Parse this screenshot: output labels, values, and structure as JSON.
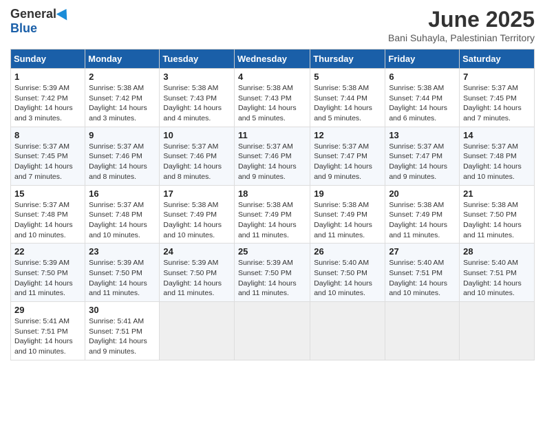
{
  "header": {
    "logo_general": "General",
    "logo_blue": "Blue",
    "month_title": "June 2025",
    "subtitle": "Bani Suhayla, Palestinian Territory"
  },
  "weekdays": [
    "Sunday",
    "Monday",
    "Tuesday",
    "Wednesday",
    "Thursday",
    "Friday",
    "Saturday"
  ],
  "weeks": [
    [
      {
        "day": "1",
        "sunrise": "Sunrise: 5:39 AM",
        "sunset": "Sunset: 7:42 PM",
        "daylight": "Daylight: 14 hours and 3 minutes."
      },
      {
        "day": "2",
        "sunrise": "Sunrise: 5:38 AM",
        "sunset": "Sunset: 7:42 PM",
        "daylight": "Daylight: 14 hours and 3 minutes."
      },
      {
        "day": "3",
        "sunrise": "Sunrise: 5:38 AM",
        "sunset": "Sunset: 7:43 PM",
        "daylight": "Daylight: 14 hours and 4 minutes."
      },
      {
        "day": "4",
        "sunrise": "Sunrise: 5:38 AM",
        "sunset": "Sunset: 7:43 PM",
        "daylight": "Daylight: 14 hours and 5 minutes."
      },
      {
        "day": "5",
        "sunrise": "Sunrise: 5:38 AM",
        "sunset": "Sunset: 7:44 PM",
        "daylight": "Daylight: 14 hours and 5 minutes."
      },
      {
        "day": "6",
        "sunrise": "Sunrise: 5:38 AM",
        "sunset": "Sunset: 7:44 PM",
        "daylight": "Daylight: 14 hours and 6 minutes."
      },
      {
        "day": "7",
        "sunrise": "Sunrise: 5:37 AM",
        "sunset": "Sunset: 7:45 PM",
        "daylight": "Daylight: 14 hours and 7 minutes."
      }
    ],
    [
      {
        "day": "8",
        "sunrise": "Sunrise: 5:37 AM",
        "sunset": "Sunset: 7:45 PM",
        "daylight": "Daylight: 14 hours and 7 minutes."
      },
      {
        "day": "9",
        "sunrise": "Sunrise: 5:37 AM",
        "sunset": "Sunset: 7:46 PM",
        "daylight": "Daylight: 14 hours and 8 minutes."
      },
      {
        "day": "10",
        "sunrise": "Sunrise: 5:37 AM",
        "sunset": "Sunset: 7:46 PM",
        "daylight": "Daylight: 14 hours and 8 minutes."
      },
      {
        "day": "11",
        "sunrise": "Sunrise: 5:37 AM",
        "sunset": "Sunset: 7:46 PM",
        "daylight": "Daylight: 14 hours and 9 minutes."
      },
      {
        "day": "12",
        "sunrise": "Sunrise: 5:37 AM",
        "sunset": "Sunset: 7:47 PM",
        "daylight": "Daylight: 14 hours and 9 minutes."
      },
      {
        "day": "13",
        "sunrise": "Sunrise: 5:37 AM",
        "sunset": "Sunset: 7:47 PM",
        "daylight": "Daylight: 14 hours and 9 minutes."
      },
      {
        "day": "14",
        "sunrise": "Sunrise: 5:37 AM",
        "sunset": "Sunset: 7:48 PM",
        "daylight": "Daylight: 14 hours and 10 minutes."
      }
    ],
    [
      {
        "day": "15",
        "sunrise": "Sunrise: 5:37 AM",
        "sunset": "Sunset: 7:48 PM",
        "daylight": "Daylight: 14 hours and 10 minutes."
      },
      {
        "day": "16",
        "sunrise": "Sunrise: 5:37 AM",
        "sunset": "Sunset: 7:48 PM",
        "daylight": "Daylight: 14 hours and 10 minutes."
      },
      {
        "day": "17",
        "sunrise": "Sunrise: 5:38 AM",
        "sunset": "Sunset: 7:49 PM",
        "daylight": "Daylight: 14 hours and 10 minutes."
      },
      {
        "day": "18",
        "sunrise": "Sunrise: 5:38 AM",
        "sunset": "Sunset: 7:49 PM",
        "daylight": "Daylight: 14 hours and 11 minutes."
      },
      {
        "day": "19",
        "sunrise": "Sunrise: 5:38 AM",
        "sunset": "Sunset: 7:49 PM",
        "daylight": "Daylight: 14 hours and 11 minutes."
      },
      {
        "day": "20",
        "sunrise": "Sunrise: 5:38 AM",
        "sunset": "Sunset: 7:49 PM",
        "daylight": "Daylight: 14 hours and 11 minutes."
      },
      {
        "day": "21",
        "sunrise": "Sunrise: 5:38 AM",
        "sunset": "Sunset: 7:50 PM",
        "daylight": "Daylight: 14 hours and 11 minutes."
      }
    ],
    [
      {
        "day": "22",
        "sunrise": "Sunrise: 5:39 AM",
        "sunset": "Sunset: 7:50 PM",
        "daylight": "Daylight: 14 hours and 11 minutes."
      },
      {
        "day": "23",
        "sunrise": "Sunrise: 5:39 AM",
        "sunset": "Sunset: 7:50 PM",
        "daylight": "Daylight: 14 hours and 11 minutes."
      },
      {
        "day": "24",
        "sunrise": "Sunrise: 5:39 AM",
        "sunset": "Sunset: 7:50 PM",
        "daylight": "Daylight: 14 hours and 11 minutes."
      },
      {
        "day": "25",
        "sunrise": "Sunrise: 5:39 AM",
        "sunset": "Sunset: 7:50 PM",
        "daylight": "Daylight: 14 hours and 11 minutes."
      },
      {
        "day": "26",
        "sunrise": "Sunrise: 5:40 AM",
        "sunset": "Sunset: 7:50 PM",
        "daylight": "Daylight: 14 hours and 10 minutes."
      },
      {
        "day": "27",
        "sunrise": "Sunrise: 5:40 AM",
        "sunset": "Sunset: 7:51 PM",
        "daylight": "Daylight: 14 hours and 10 minutes."
      },
      {
        "day": "28",
        "sunrise": "Sunrise: 5:40 AM",
        "sunset": "Sunset: 7:51 PM",
        "daylight": "Daylight: 14 hours and 10 minutes."
      }
    ],
    [
      {
        "day": "29",
        "sunrise": "Sunrise: 5:41 AM",
        "sunset": "Sunset: 7:51 PM",
        "daylight": "Daylight: 14 hours and 10 minutes."
      },
      {
        "day": "30",
        "sunrise": "Sunrise: 5:41 AM",
        "sunset": "Sunset: 7:51 PM",
        "daylight": "Daylight: 14 hours and 9 minutes."
      },
      null,
      null,
      null,
      null,
      null
    ]
  ]
}
